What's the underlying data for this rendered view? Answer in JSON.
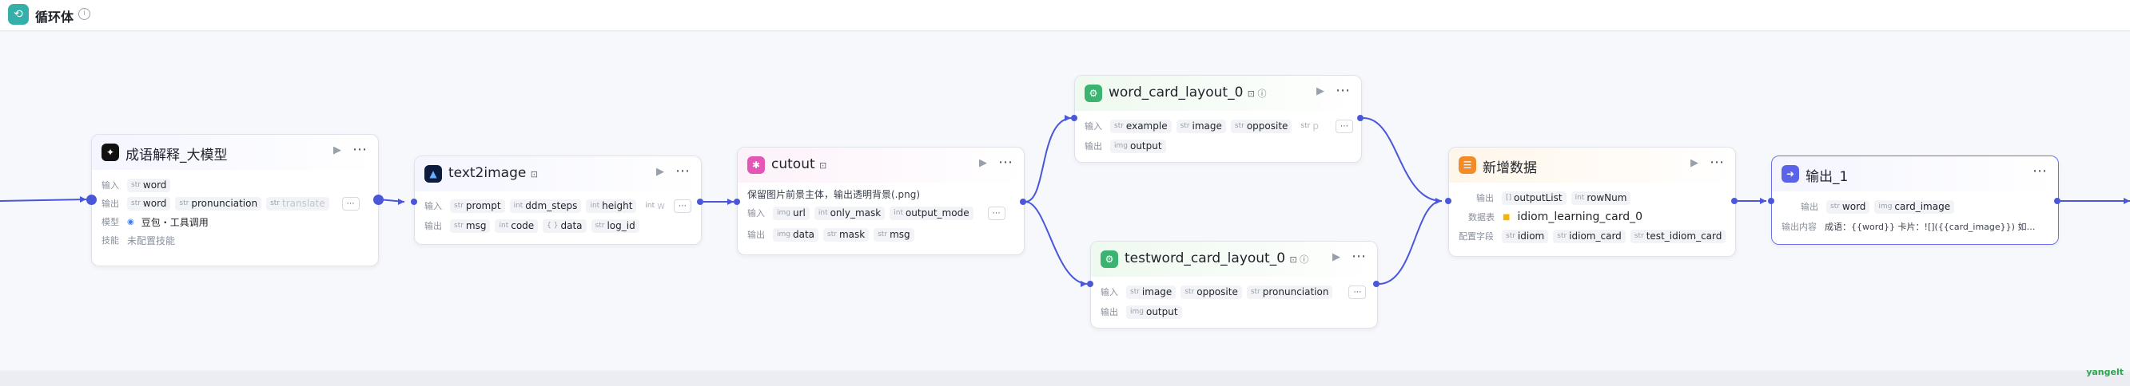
{
  "header": {
    "title": "循环体",
    "info_icon": "info-icon",
    "loop_icon": "loop-icon"
  },
  "brand": "yangelt",
  "colors": {
    "edge": "#4a57d9",
    "loop_accent": "#35b0a8"
  },
  "nodes": {
    "llm": {
      "title": "成语解释_大模型",
      "input_label": "输入",
      "output_label": "输出",
      "model_label": "模型",
      "skill_label": "技能",
      "inputs": [
        {
          "type": "str",
          "name": "word"
        }
      ],
      "outputs": [
        {
          "type": "str",
          "name": "word"
        },
        {
          "type": "str",
          "name": "pronunciation"
        },
        {
          "type": "str",
          "name": "translate"
        }
      ],
      "model": "豆包・工具调用",
      "skill": "未配置技能"
    },
    "t2i": {
      "title": "text2image",
      "input_label": "输入",
      "output_label": "输出",
      "inputs": [
        {
          "type": "str",
          "name": "prompt"
        },
        {
          "type": "int",
          "name": "ddm_steps"
        },
        {
          "type": "int",
          "name": "height"
        },
        {
          "type": "int",
          "name": "w"
        }
      ],
      "outputs": [
        {
          "type": "str",
          "name": "msg"
        },
        {
          "type": "int",
          "name": "code"
        },
        {
          "type": "{ }",
          "name": "data"
        },
        {
          "type": "str",
          "name": "log_id"
        }
      ]
    },
    "cutout": {
      "title": "cutout",
      "desc": "保留图片前景主体，输出透明背景(.png)",
      "input_label": "输入",
      "output_label": "输出",
      "inputs": [
        {
          "type": "img",
          "name": "url"
        },
        {
          "type": "int",
          "name": "only_mask"
        },
        {
          "type": "int",
          "name": "output_mode"
        }
      ],
      "outputs": [
        {
          "type": "img",
          "name": "data"
        },
        {
          "type": "str",
          "name": "mask"
        },
        {
          "type": "str",
          "name": "msg"
        }
      ]
    },
    "word_card": {
      "title": "word_card_layout_0",
      "input_label": "输入",
      "output_label": "输出",
      "inputs": [
        {
          "type": "str",
          "name": "example"
        },
        {
          "type": "str",
          "name": "image"
        },
        {
          "type": "str",
          "name": "opposite"
        },
        {
          "type": "str",
          "name": "p"
        }
      ],
      "outputs": [
        {
          "type": "img",
          "name": "output"
        }
      ]
    },
    "test_card": {
      "title": "testword_card_layout_0",
      "input_label": "输入",
      "output_label": "输出",
      "inputs": [
        {
          "type": "str",
          "name": "image"
        },
        {
          "type": "str",
          "name": "opposite"
        },
        {
          "type": "str",
          "name": "pronunciation"
        }
      ],
      "outputs": [
        {
          "type": "img",
          "name": "output"
        }
      ]
    },
    "add_data": {
      "title": "新增数据",
      "output_label": "输出",
      "table_label": "数据表",
      "fields_label": "配置字段",
      "outputs": [
        {
          "type": "[]",
          "name": "outputList"
        },
        {
          "type": "int",
          "name": "rowNum"
        }
      ],
      "table": "idiom_learning_card_0",
      "fields": [
        {
          "type": "str",
          "name": "idiom"
        },
        {
          "type": "str",
          "name": "idiom_card"
        },
        {
          "type": "str",
          "name": "test_idiom_card"
        }
      ]
    },
    "output": {
      "title": "输出_1",
      "output_label": "输出",
      "content_label": "输出内容",
      "outputs": [
        {
          "type": "str",
          "name": "word"
        },
        {
          "type": "img",
          "name": "card_image"
        }
      ],
      "content": "成语：{{word}} 卡片：![]({{card_image}}) 如…"
    }
  }
}
